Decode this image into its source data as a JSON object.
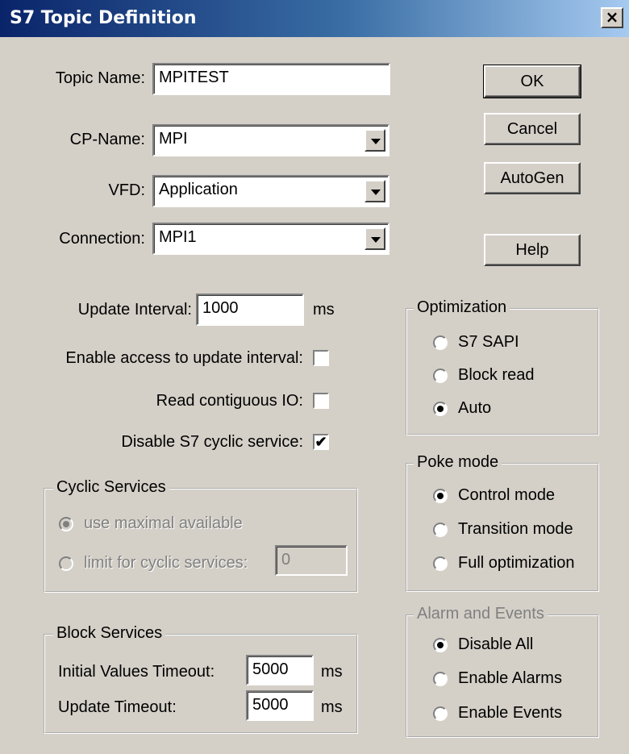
{
  "window": {
    "title": "S7 Topic Definition",
    "close_label": "×"
  },
  "fields": {
    "topic_name": {
      "label": "Topic Name:",
      "value": "MPITEST"
    },
    "cp_name": {
      "label": "CP-Name:",
      "value": "MPI"
    },
    "vfd": {
      "label": "VFD:",
      "value": "Application"
    },
    "connection": {
      "label": "Connection:",
      "value": "MPI1"
    },
    "update_interval": {
      "label": "Update Interval:",
      "value": "1000",
      "unit": "ms"
    }
  },
  "buttons": {
    "ok": "OK",
    "cancel": "Cancel",
    "autogen": "AutoGen",
    "help": "Help"
  },
  "checkboxes": {
    "enable_access": {
      "label": "Enable access to update interval:",
      "checked": false
    },
    "read_contiguous": {
      "label": "Read contiguous IO:",
      "checked": false
    },
    "disable_cyclic": {
      "label": "Disable S7 cyclic service:",
      "checked": true,
      "mark": "✔"
    }
  },
  "cyclic_services": {
    "title": "Cyclic Services",
    "use_maximal": "use maximal available",
    "limit": "limit for cyclic services:",
    "limit_value": "0"
  },
  "block_services": {
    "title": "Block Services",
    "initial_timeout_label": "Initial Values Timeout:",
    "initial_timeout_value": "5000",
    "update_timeout_label": "Update Timeout:",
    "update_timeout_value": "5000",
    "unit": "ms"
  },
  "optimization": {
    "title": "Optimization",
    "options": [
      "S7 SAPI",
      "Block read",
      "Auto"
    ],
    "selected": "Auto"
  },
  "poke_mode": {
    "title": "Poke mode",
    "options": [
      "Control mode",
      "Transition mode",
      "Full optimization"
    ],
    "selected": "Control mode"
  },
  "alarm_events": {
    "title": "Alarm and Events",
    "options": [
      "Disable All",
      "Enable Alarms",
      "Enable Events"
    ],
    "selected": "Disable All"
  }
}
